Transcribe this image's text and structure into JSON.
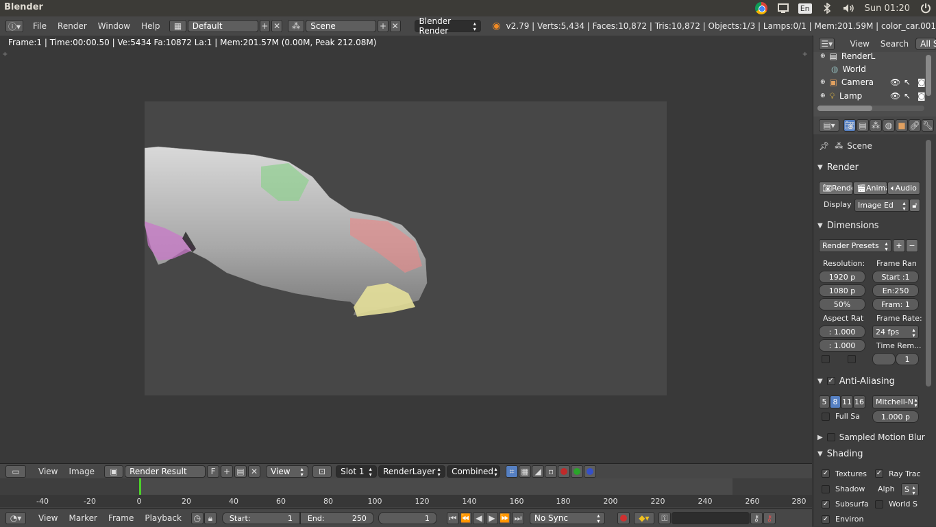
{
  "os": {
    "app_title": "Blender",
    "lang": "En",
    "clock": "Sun 01:20"
  },
  "info_header": {
    "menus": [
      "File",
      "Render",
      "Window",
      "Help"
    ],
    "screen_layout": "Default",
    "scene": "Scene",
    "engine": "Blender Render",
    "stats": "v2.79 | Verts:5,434 | Faces:10,872 | Tris:10,872 | Objects:1/3 | Lamps:0/1 | Mem:201.59M | color_car.001"
  },
  "image_editor": {
    "frame_info": "Frame:1 | Time:00:00.50 | Ve:5434 Fa:10872 La:1 | Mem:201.57M (0.00M, Peak 212.08M)"
  },
  "image_header": {
    "menus": [
      "View",
      "Image"
    ],
    "image_name": "Render Result",
    "fake_user": "F",
    "view_menu": "View",
    "slot": "Slot 1",
    "render_layer": "RenderLayer",
    "pass": "Combined"
  },
  "timeline": {
    "ticks": [
      "-40",
      "-20",
      "0",
      "20",
      "40",
      "60",
      "80",
      "100",
      "120",
      "140",
      "160",
      "180",
      "200",
      "220",
      "240",
      "260",
      "280"
    ],
    "menus": [
      "View",
      "Marker",
      "Frame",
      "Playback"
    ],
    "start_label": "Start:",
    "start": "1",
    "end_label": "End:",
    "end": "250",
    "current": "1",
    "sync": "No Sync"
  },
  "outliner": {
    "view_menu": "View",
    "search_menu": "Search",
    "filter": "All Sc",
    "items": [
      "RenderL",
      "World",
      "Camera",
      "Lamp"
    ]
  },
  "properties": {
    "context": "Scene",
    "render_panel": {
      "title": "Render",
      "render_btn": "Rende",
      "anim_btn": "Anima",
      "audio_btn": "Audio",
      "display_label": "Display",
      "display_value": "Image Ed"
    },
    "dimensions_panel": {
      "title": "Dimensions",
      "presets": "Render Presets",
      "resolution_label": "Resolution:",
      "res_x": "1920 p",
      "res_y": "1080 p",
      "res_pct": "50%",
      "frame_range_label": "Frame Ran",
      "start": "Start :1",
      "end": "En:250",
      "frame_step": "Fram: 1",
      "aspect_label": "Aspect Rat",
      "aspect_x": ": 1.000",
      "aspect_y": ": 1.000",
      "frame_rate_label": "Frame Rate:",
      "frame_rate": "24 fps",
      "time_remap_label": "Time Rem...",
      "time_remap": "1"
    },
    "aa_panel": {
      "title": "Anti-Aliasing",
      "samples": [
        "5",
        "8",
        "11",
        "16"
      ],
      "filter": "Mitchell-N",
      "full_sample": "Full Sa",
      "filter_size": "1.000 p"
    },
    "motion_blur_title": "Sampled Motion Blur",
    "shading_panel": {
      "title": "Shading",
      "textures": "Textures",
      "ray_trace": "Ray Trac",
      "shadow": "Shadow",
      "alpha_label": "Alph",
      "alpha_value": "S",
      "subsurface": "Subsurfa",
      "world_space": "World S",
      "environment": "Environ"
    }
  },
  "colors": {
    "accent_blue": "#5680c2",
    "playhead_green": "#4cd02a"
  }
}
